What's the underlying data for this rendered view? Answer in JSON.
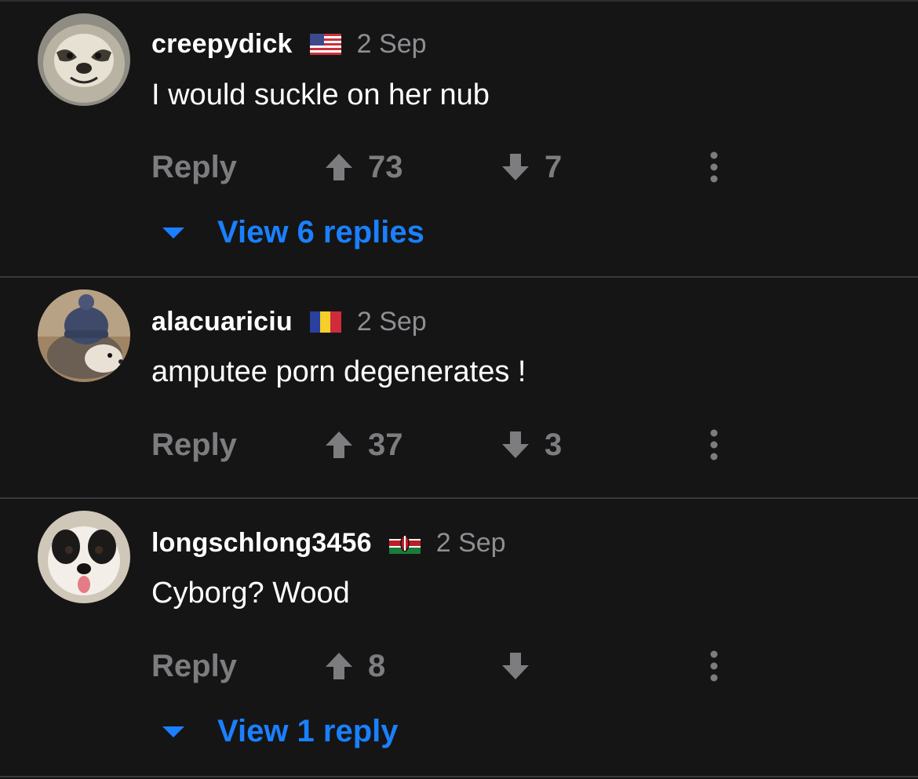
{
  "comments": [
    {
      "username": "creepydick",
      "flag_icon": "us-flag-icon",
      "date": "2 Sep",
      "text": "I would suckle on her nub",
      "reply_label": "Reply",
      "upvotes": "73",
      "downvotes": "7",
      "avatar": "sloth-avatar",
      "view_replies": "View 6 replies"
    },
    {
      "username": "alacuariciu",
      "flag_icon": "romania-flag-icon",
      "date": "2 Sep",
      "text": "amputee porn degenerates !",
      "reply_label": "Reply",
      "upvotes": "37",
      "downvotes": "3",
      "avatar": "hedgehog-avatar"
    },
    {
      "username": "longschlong3456",
      "flag_icon": "kenya-flag-icon",
      "date": "2 Sep",
      "text": "Cyborg? Wood",
      "reply_label": "Reply",
      "upvotes": "8",
      "downvotes": "",
      "avatar": "dog-avatar",
      "view_replies": "View 1 reply"
    }
  ],
  "colors": {
    "background": "#151516",
    "link": "#1a80ff",
    "muted": "#7d7d80",
    "date": "#8e8e93"
  }
}
